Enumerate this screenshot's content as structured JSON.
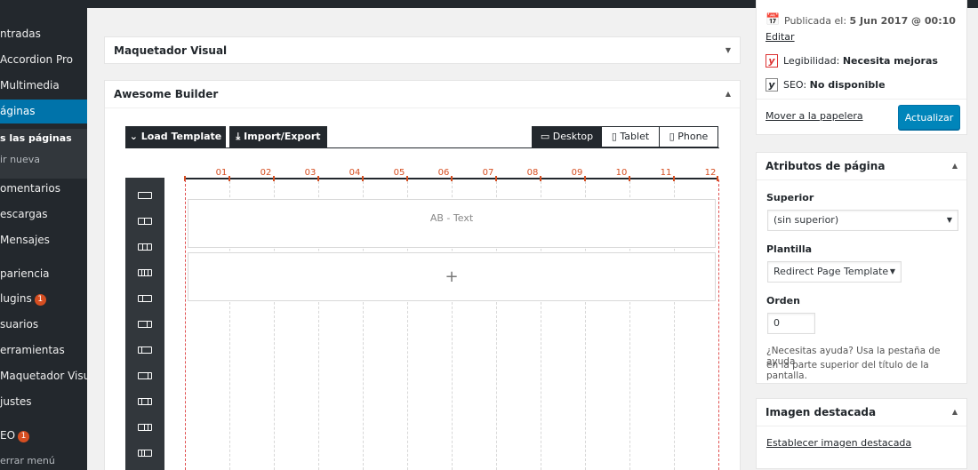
{
  "sidebar": {
    "items": [
      {
        "label": "ntradas"
      },
      {
        "label": "Accordion Pro"
      },
      {
        "label": "Multimedia"
      },
      {
        "label": "áginas"
      },
      {
        "label": "omentarios"
      },
      {
        "label": "escargas"
      },
      {
        "label": "Mensajes"
      },
      {
        "label": "pariencia"
      },
      {
        "label": "lugins",
        "badge": "1"
      },
      {
        "label": "suarios"
      },
      {
        "label": "erramientas"
      },
      {
        "label": "Maquetador Visual"
      },
      {
        "label": "justes"
      },
      {
        "label": "EO",
        "badge": "1"
      },
      {
        "label": "errar menú"
      }
    ],
    "submenu": [
      {
        "label": "s las páginas"
      },
      {
        "label": "ir nueva"
      }
    ]
  },
  "maquetador": {
    "title": "Maquetador Visual"
  },
  "builder": {
    "title": "Awesome Builder",
    "load_template": "Load Template",
    "import_export": "Import/Export",
    "devices": [
      "Desktop",
      "Tablet",
      "Phone"
    ],
    "columns": [
      "01",
      "02",
      "03",
      "04",
      "05",
      "06",
      "07",
      "08",
      "09",
      "10",
      "11",
      "12"
    ],
    "module_text": "AB - Text",
    "add_symbol": "+"
  },
  "publish": {
    "published_label": "Publicada el:",
    "published_date": "5 Jun 2017 @ 00:10",
    "edit_link": "Editar",
    "readability_label": "Legibilidad:",
    "readability_value": "Necesita mejoras",
    "seo_label": "SEO:",
    "seo_value": "No disponible",
    "trash_link": "Mover a la papelera",
    "update_button": "Actualizar"
  },
  "page_attributes": {
    "title": "Atributos de página",
    "parent_label": "Superior",
    "parent_value": "(sin superior)",
    "template_label": "Plantilla",
    "template_value": "Redirect Page Template",
    "order_label": "Orden",
    "order_value": "0",
    "help_line1": "¿Necesitas ayuda? Usa la pestaña de ayuda",
    "help_line2": "en la parte superior del título de la pantalla."
  },
  "featured_image": {
    "title": "Imagen destacada",
    "set_link": "Establecer imagen destacada"
  },
  "colors": {
    "admin_dark": "#23282d",
    "accent_blue": "#0073aa",
    "grid_red": "#d54e21"
  }
}
